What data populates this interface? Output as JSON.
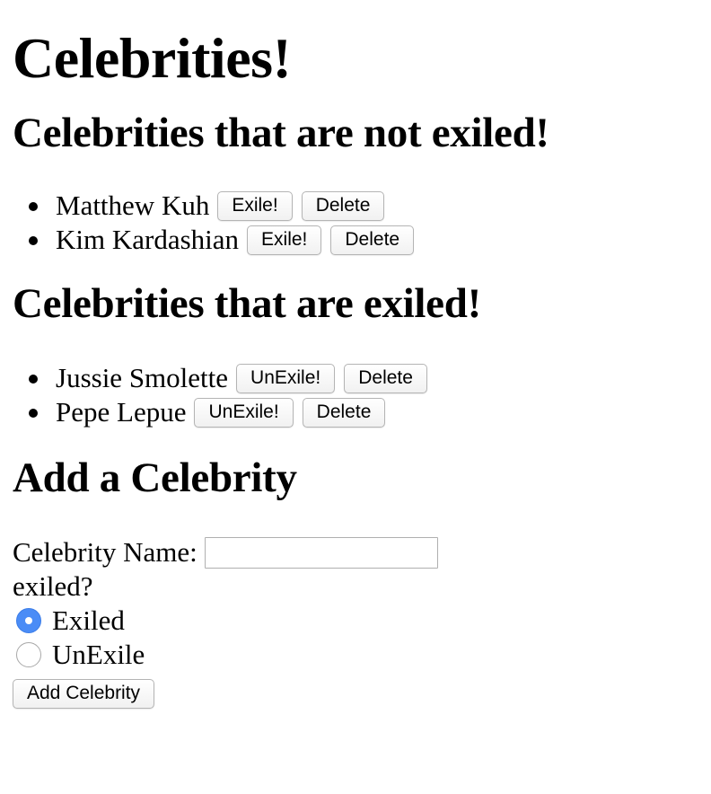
{
  "page": {
    "title": "Celebrities!"
  },
  "not_exiled": {
    "heading": "Celebrities that are not exiled!",
    "items": [
      {
        "name": "Matthew Kuh",
        "toggle_label": "Exile!",
        "delete_label": "Delete"
      },
      {
        "name": "Kim Kardashian",
        "toggle_label": "Exile!",
        "delete_label": "Delete"
      }
    ]
  },
  "exiled": {
    "heading": "Celebrities that are exiled!",
    "items": [
      {
        "name": "Jussie Smolette",
        "toggle_label": "UnExile!",
        "delete_label": "Delete"
      },
      {
        "name": "Pepe Lepue",
        "toggle_label": "UnExile!",
        "delete_label": "Delete"
      }
    ]
  },
  "add_form": {
    "heading": "Add a Celebrity",
    "name_label": "Celebrity Name:",
    "name_value": "",
    "exiled_label": "exiled?",
    "options": [
      {
        "label": "Exiled",
        "checked": true
      },
      {
        "label": "UnExile",
        "checked": false
      }
    ],
    "submit_label": "Add Celebrity"
  },
  "colors": {
    "radio_checked": "#4a8cf6",
    "text": "#000000",
    "background": "#ffffff"
  }
}
